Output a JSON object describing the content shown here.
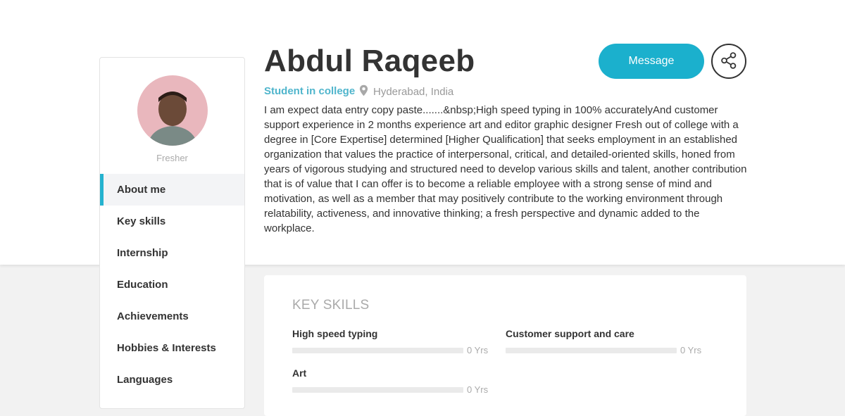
{
  "profile": {
    "name": "Abdul Raqeeb",
    "status": "Student in college",
    "location": "Hyderabad, India",
    "level": "Fresher",
    "bio": "I am expect data entry copy paste.......&nbsp;High speed typing in 100% accuratelyAnd customer support experience in 2 months experience art and editor graphic designer Fresh out of college with a degree in [Core Expertise] determined [Higher Qualification] that seeks employment in an established organization that values the practice of interpersonal, critical, and detailed-oriented skills, honed from years of vigorous studying and structured need to develop various skills and talent, another contribution that is of value that I can offer is to become a reliable employee with a strong sense of mind and motivation, as well as a member that may positively contribute to the working environment through relatability, activeness, and innovative thinking; a fresh perspective and dynamic added to the workplace."
  },
  "actions": {
    "message_label": "Message",
    "share_icon": "share-icon"
  },
  "sidebar": {
    "items": [
      {
        "label": "About me",
        "active": true
      },
      {
        "label": "Key skills",
        "active": false
      },
      {
        "label": "Internship",
        "active": false
      },
      {
        "label": "Education",
        "active": false
      },
      {
        "label": "Achievements",
        "active": false
      },
      {
        "label": "Hobbies & Interests",
        "active": false
      },
      {
        "label": "Languages",
        "active": false
      }
    ]
  },
  "key_skills": {
    "title": "KEY SKILLS",
    "items": [
      {
        "name": "High speed typing",
        "years": "0 Yrs",
        "level": 0
      },
      {
        "name": "Customer support and care",
        "years": "0 Yrs",
        "level": 0
      },
      {
        "name": "Art",
        "years": "0 Yrs",
        "level": 0
      }
    ]
  },
  "colors": {
    "accent": "#1bb0cd",
    "status_text": "#4fb5cc",
    "muted": "#999999"
  }
}
